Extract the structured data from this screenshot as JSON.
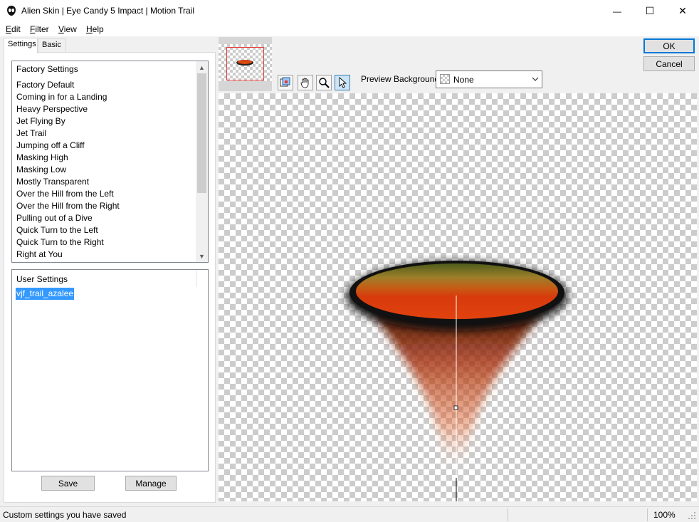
{
  "window": {
    "title": "Alien Skin | Eye Candy 5 Impact | Motion Trail",
    "minimize_glyph": "—",
    "maximize_glyph": "☐",
    "close_glyph": "✕"
  },
  "menu": {
    "items": [
      {
        "key": "E",
        "rest": "dit"
      },
      {
        "key": "F",
        "rest": "ilter"
      },
      {
        "key": "V",
        "rest": "iew"
      },
      {
        "key": "H",
        "rest": "elp"
      }
    ]
  },
  "tabs": [
    "Settings",
    "Basic"
  ],
  "factory_settings": {
    "header": "Factory Settings",
    "items": [
      "Factory Default",
      "Coming in for a Landing",
      "Heavy Perspective",
      "Jet Flying By",
      "Jet Trail",
      "Jumping off a Cliff",
      "Masking High",
      "Masking Low",
      "Mostly Transparent",
      "Over the Hill from the Left",
      "Over the Hill from the Right",
      "Pulling out of a Dive",
      "Quick Turn to the Left",
      "Quick Turn to the Right",
      "Right at You"
    ]
  },
  "user_settings": {
    "header": "User Settings",
    "items": [
      "vjf_trail_azalee"
    ],
    "selected": "vjf_trail_azalee"
  },
  "buttons": {
    "save": "Save",
    "manage": "Manage",
    "ok": "OK",
    "cancel": "Cancel"
  },
  "toolbar": {
    "icons": [
      "navigator-icon",
      "hand-pan-icon",
      "zoom-magnifier-icon",
      "arrow-pointer-icon"
    ],
    "active_tool": "arrow-pointer-icon"
  },
  "preview_background": {
    "label": "Preview Background:",
    "value": "None"
  },
  "status": {
    "text": "Custom settings you have saved",
    "zoom": "100%"
  },
  "colors": {
    "selection": "#3399ff",
    "ok_border": "#0078d7",
    "thumbnail_marker": "#e53935"
  }
}
